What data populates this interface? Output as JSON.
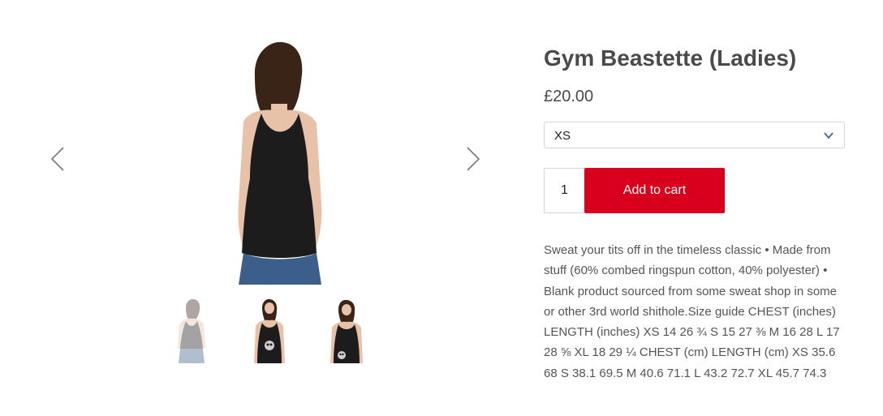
{
  "product": {
    "title": "Gym Beastette (Ladies)",
    "price": "£20.00",
    "size_select": {
      "selected": "XS"
    },
    "quantity": "1",
    "add_to_cart_label": "Add to cart",
    "description": "Sweat your tits off in the timeless classic • Made from stuff (60% combed ringspun cotton, 40% polyester) • Blank product sourced from some sweat shop in some or other 3rd world shithole.Size guide CHEST (inches) LENGTH (inches) XS 14 26 ¾ S 15 27 ⅜ M 16 28 L 17 28 ⅝ XL 18 29 ¼ CHEST (cm) LENGTH (cm) XS 35.6 68 S 38.1 69.5 M 40.6 71.1 L 43.2 72.7 XL 45.7 74.3"
  },
  "gallery": {
    "prev_icon": "chevron-left-icon",
    "next_icon": "chevron-right-icon",
    "thumbnails": [
      {
        "name": "thumbnail-back-view",
        "active": true
      },
      {
        "name": "thumbnail-front-view-1",
        "active": false
      },
      {
        "name": "thumbnail-front-view-2",
        "active": false
      }
    ]
  },
  "colors": {
    "accent": "#d9001e",
    "text": "#4a4a4a",
    "border": "#d6d6d6",
    "shirt": "#1c1c1c",
    "jeans": "#3b5f8a",
    "hair": "#3a2418",
    "skin": "#e8c2a8"
  }
}
